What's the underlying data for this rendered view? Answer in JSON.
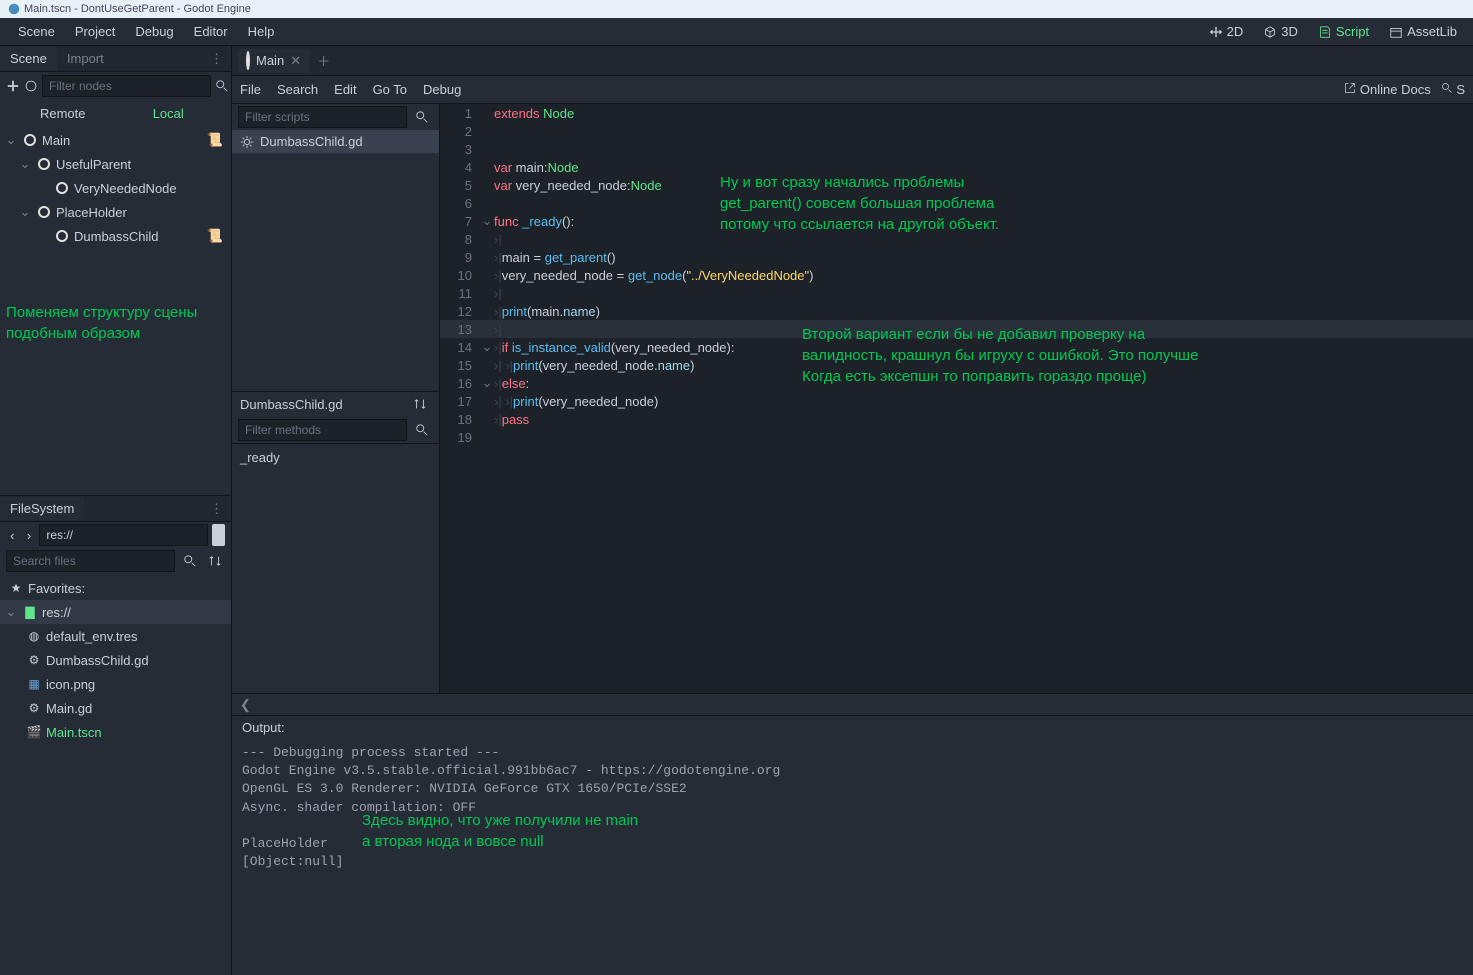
{
  "titlebar": "Main.tscn - DontUseGetParent - Godot Engine",
  "menubar": [
    "Scene",
    "Project",
    "Debug",
    "Editor",
    "Help"
  ],
  "modes": {
    "d2": "2D",
    "d3": "3D",
    "script": "Script",
    "assetlib": "AssetLib"
  },
  "leftTabs": {
    "scene": "Scene",
    "import": "Import"
  },
  "sceneFilter": "Filter nodes",
  "remote": "Remote",
  "local": "Local",
  "tree": {
    "root": "Main",
    "c1": "UsefulParent",
    "c1a": "VeryNeededNode",
    "c2": "PlaceHolder",
    "c2a": "DumbassChild"
  },
  "overlay1_l1": "Поменяем структуру сцены",
  "overlay1_l2": "подобным образом",
  "fsTab": "FileSystem",
  "fsPath": "res://",
  "fsSearch": "Search files",
  "favorites": "Favorites:",
  "resRoot": "res://",
  "files": {
    "env": "default_env.tres",
    "dc": "DumbassChild.gd",
    "icon": "icon.png",
    "main": "Main.gd",
    "tscn": "Main.tscn"
  },
  "sceneTab": "Main",
  "scriptMenu": {
    "file": "File",
    "search": "Search",
    "edit": "Edit",
    "goto": "Go To",
    "debug": "Debug",
    "docs": "Online Docs",
    "searchHelp": "S"
  },
  "scriptFilter": "Filter scripts",
  "scriptFile": "DumbassChild.gd",
  "methodFilter": "Filter methods",
  "method": "_ready",
  "code": {
    "l1a": "extends",
    "l1b": " Node",
    "l4a": "var",
    "l4b": " main:",
    "l4c": "Node",
    "l5a": "var",
    "l5b": " very_needed_node:",
    "l5c": "Node",
    "l7a": "func",
    "l7b": " _ready",
    "l7c": "():",
    "l9a": "main = ",
    "l9b": "get_parent",
    "l9c": "()",
    "l10a": "very_needed_node = ",
    "l10b": "get_node",
    "l10c": "(",
    "l10d": "\"../VeryNeededNode\"",
    "l10e": ")",
    "l12a": "print",
    "l12b": "(main.",
    "l12c": "name",
    "l12d": ")",
    "l14a": "if",
    "l14b": " is_instance_valid",
    "l14c": "(very_needed_node):",
    "l15a": "print",
    "l15b": "(very_needed_node.",
    "l15c": "name",
    "l15d": ")",
    "l16a": "else",
    "l16b": ":",
    "l17a": "print",
    "l17b": "(very_needed_node)",
    "l18a": "pass"
  },
  "ln": {
    "1": "1",
    "2": "2",
    "3": "3",
    "4": "4",
    "5": "5",
    "6": "6",
    "7": "7",
    "8": "8",
    "9": "9",
    "10": "10",
    "11": "11",
    "12": "12",
    "13": "13",
    "14": "14",
    "15": "15",
    "16": "16",
    "17": "17",
    "18": "18",
    "19": "19"
  },
  "overlay2_l1": "Ну и вот сразу начались проблемы",
  "overlay2_l2": "get_parent() совсем большая проблема",
  "overlay2_l3": "потому что ссылается на другой объект.",
  "overlay3_l1": "Второй вариант если бы не добавил проверку на",
  "overlay3_l2": "валидность, крашнул бы игруху с ошибкой. Это получше",
  "overlay3_l3": "Когда есть эксепшн то поправить гораздо проще)",
  "outputLabel": "Output:",
  "output": "--- Debugging process started ---\nGodot Engine v3.5.stable.official.991bb6ac7 - https://godotengine.org\nOpenGL ES 3.0 Renderer: NVIDIA GeForce GTX 1650/PCIe/SSE2\nAsync. shader compilation: OFF\n \nPlaceHolder\n[Object:null]",
  "overlay4_l1": "Здесь видно, что уже получили не main",
  "overlay4_l2": "а вторая нода и вовсе null"
}
